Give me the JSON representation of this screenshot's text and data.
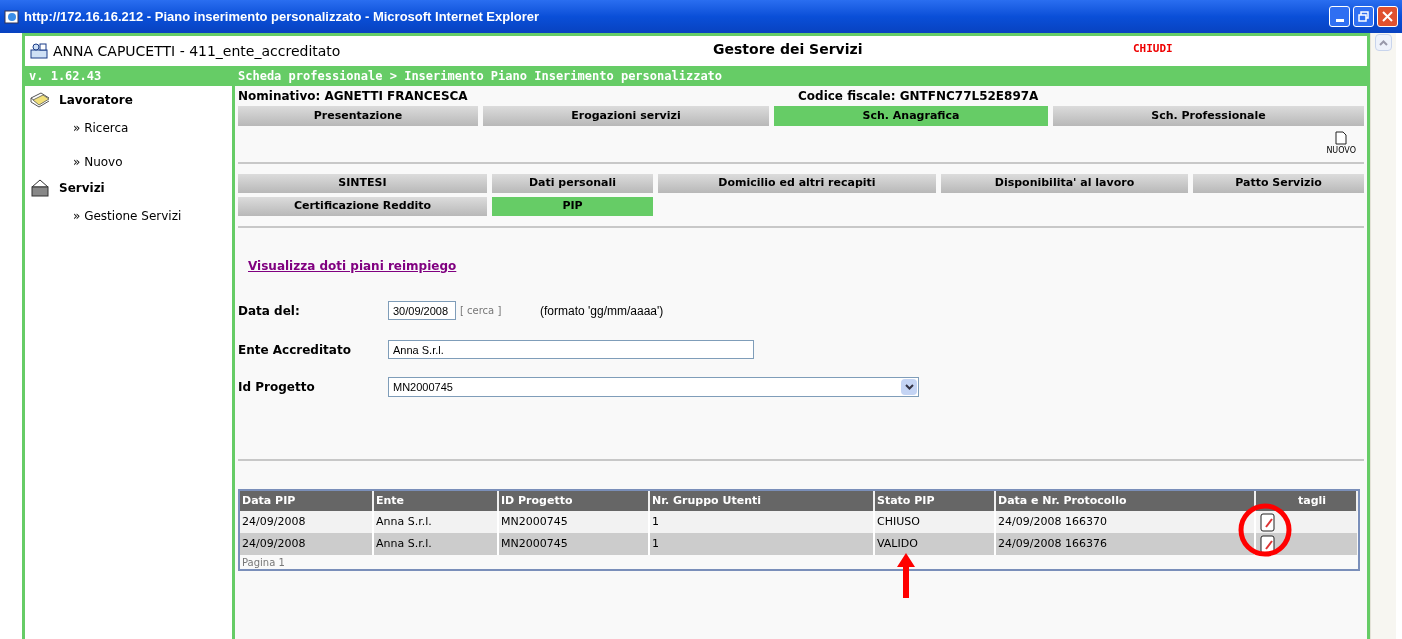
{
  "window": {
    "title": "http://172.16.16.212 - Piano inserimento personalizzato - Microsoft Internet Explorer"
  },
  "header": {
    "user": "ANNA CAPUCETTI - 411_ente_accreditato",
    "app_title": "Gestore dei Servizi",
    "close_link": "CHIUDI"
  },
  "version": "v. 1.62.43",
  "breadcrumb": "Scheda professionale > Inserimento Piano Inserimento personalizzato",
  "sidebar": {
    "sections": [
      {
        "title": "Lavoratore",
        "kind": "folder",
        "items": [
          "» Ricerca",
          "» Nuovo"
        ]
      },
      {
        "title": "Servizi",
        "kind": "basket",
        "items": [
          "» Gestione Servizi"
        ]
      }
    ]
  },
  "person": {
    "name_label": "Nominativo:",
    "name": "AGNETTI  FRANCESCA",
    "cf_label": "Codice fiscale:",
    "cf": "GNTFNC77L52E897A"
  },
  "main_tabs": [
    {
      "label": "Presentazione",
      "selected": false
    },
    {
      "label": "Erogazioni servizi",
      "selected": false
    },
    {
      "label": "Sch. Anagrafica",
      "selected": true
    },
    {
      "label": "Sch. Professionale",
      "selected": false
    }
  ],
  "new_button": "NUOVO",
  "sub_tabs": [
    {
      "label": "SINTESI",
      "selected": false
    },
    {
      "label": "Dati personali",
      "selected": false
    },
    {
      "label": "Domicilio ed altri recapiti",
      "selected": false
    },
    {
      "label": "Disponibilita' al lavoro",
      "selected": false
    },
    {
      "label": "Patto Servizio",
      "selected": false
    },
    {
      "label": "Certificazione Reddito",
      "selected": false
    },
    {
      "label": "PIP",
      "selected": true
    }
  ],
  "link": "Visualizza doti piani reimpiego",
  "form": {
    "date_label": "Data del:",
    "date_value": "30/09/2008",
    "search_link": "[ cerca ]",
    "date_hint": "(formato 'gg/mm/aaaa')",
    "ente_label": "Ente Accreditato",
    "ente_value": "Anna S.r.l.",
    "project_label": "Id Progetto",
    "project_value": "MN2000745"
  },
  "table": {
    "columns": [
      "Data PIP",
      "Ente",
      "ID Progetto",
      "Nr. Gruppo Utenti",
      "Stato PIP",
      "Data e Nr. Protocollo",
      "tagli"
    ],
    "rows": [
      [
        "24/09/2008",
        "Anna S.r.l.",
        "MN2000745",
        "1",
        "CHIUSO",
        "24/09/2008 166370"
      ],
      [
        "24/09/2008",
        "Anna S.r.l.",
        "MN2000745",
        "1",
        "VALIDO",
        "24/09/2008 166376"
      ]
    ],
    "pager": "Pagina 1"
  }
}
